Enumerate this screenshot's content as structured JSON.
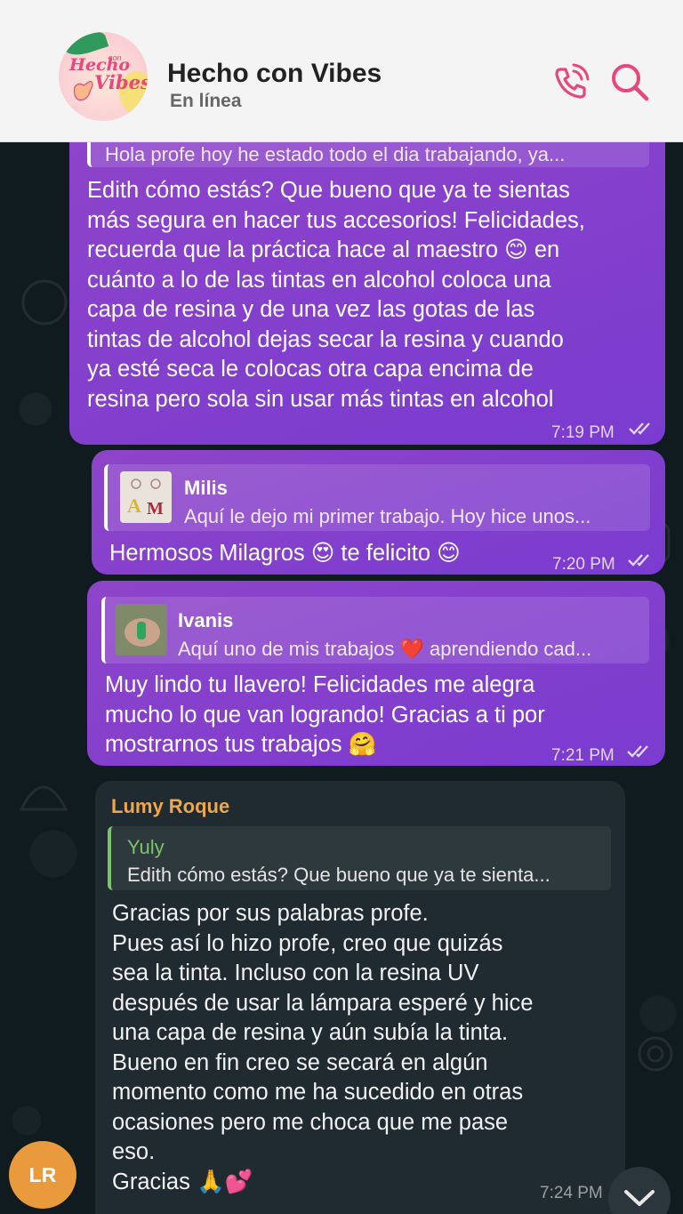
{
  "header": {
    "title": "Hecho con Vibes",
    "status": "En línea",
    "logo_text": "Hecho con Vibes",
    "accent": "#e8467c",
    "icons": [
      "phone-call-icon",
      "search-icon"
    ]
  },
  "messages": [
    {
      "reply": {
        "text": "Hola profe hoy he estado todo el dia trabajando, ya..."
      },
      "text": "Edith cómo estás? Que bueno que ya te sientas\nmás segura en hacer tus accesorios! Felicidades,\nrecuerda que la práctica hace al maestro 😊 en\ncuánto a lo de las tintas en alcohol coloca una\ncapa de resina y de una vez las gotas de las\ntintas de alcohol dejas secar la resina y cuando\nya esté seca le colocas otra capa encima de\nresina pero sola sin usar más tintas en alcohol",
      "time": "7:19 PM"
    },
    {
      "reply": {
        "name": "Milis",
        "text": "Aquí le dejo mi primer trabajo. Hoy hice unos..."
      },
      "text": "Hermosos Milagros 😍 te felicito 😊",
      "time": "7:20 PM"
    },
    {
      "reply": {
        "name": "Ivanis",
        "text": "Aquí uno de mis trabajos ❤️ aprendiendo cad..."
      },
      "text": "Muy lindo tu llavero! Felicidades me alegra\nmucho lo que van logrando! Gracias a ti por\nmostrarnos tus trabajos 🤗",
      "time": "7:21 PM"
    },
    {
      "sender": "Lumy Roque",
      "reply": {
        "name": "Yuly",
        "text": "Edith cómo estás? Que bueno que ya te sienta..."
      },
      "text": "Gracias por sus palabras profe.\nPues así lo hizo profe, creo que quizás\nsea la tinta. Incluso con la resina UV\ndespués de usar la lámpara esperé y hice\nuna capa de resina y aún subía la tinta.\nBueno en fin creo se secará en algún\nmomento como me ha sucedido en otras\nocasiones pero me choca que me pase\neso.\nGracias 🙏💕",
      "time": "7:24 PM",
      "avatar": "LR",
      "sender_color": "#f0a64a",
      "reply_color": "#7cc36b"
    }
  ]
}
